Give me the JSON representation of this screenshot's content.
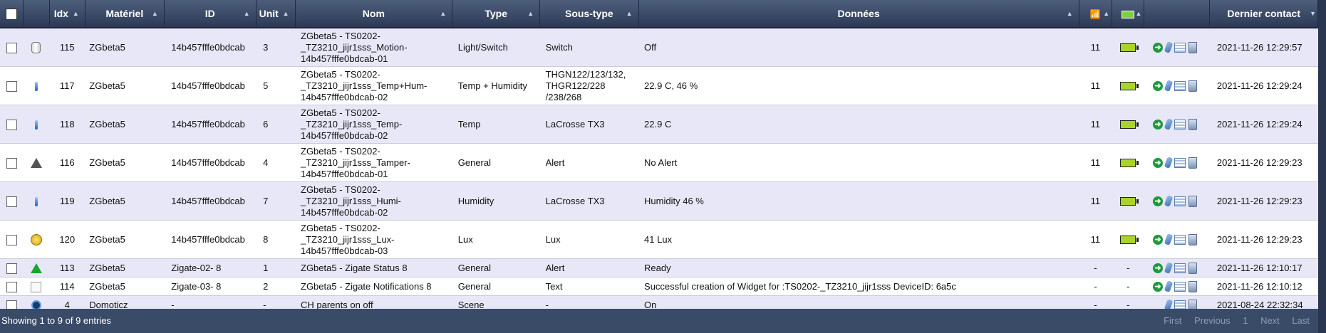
{
  "header": {
    "idx": "Idx",
    "materiel": "Matériel",
    "id": "ID",
    "unit": "Unit",
    "nom": "Nom",
    "type": "Type",
    "soustype": "Sous-type",
    "donnees": "Données",
    "dernier": "Dernier contact"
  },
  "rows": [
    {
      "icon": "cylinder-icon",
      "idx": "115",
      "mat": "ZGbeta5",
      "id": "14b457fffe0bdcab",
      "unit": "3",
      "nom_lines": [
        "ZGbeta5 - TS0202-",
        "_TZ3210_jijr1sss_Motion-",
        "14b457fffe0bdcab-01"
      ],
      "type": "Light/Switch",
      "sub_lines": [
        "Switch"
      ],
      "data": "Off",
      "signal": "11",
      "battery": true,
      "go": true,
      "last": "2021-11-26 12:29:57"
    },
    {
      "icon": "thermometer-icon",
      "idx": "117",
      "mat": "ZGbeta5",
      "id": "14b457fffe0bdcab",
      "unit": "5",
      "nom_lines": [
        "ZGbeta5 - TS0202-",
        "_TZ3210_jijr1sss_Temp+Hum-",
        "14b457fffe0bdcab-02"
      ],
      "type": "Temp + Humidity",
      "sub_lines": [
        "THGN122/123/132,",
        "THGR122/228",
        "/238/268"
      ],
      "data": "22.9 C, 46 %",
      "signal": "11",
      "battery": true,
      "go": true,
      "last": "2021-11-26 12:29:24"
    },
    {
      "icon": "thermometer-icon",
      "idx": "118",
      "mat": "ZGbeta5",
      "id": "14b457fffe0bdcab",
      "unit": "6",
      "nom_lines": [
        "ZGbeta5 - TS0202-",
        "_TZ3210_jijr1sss_Temp-",
        "14b457fffe0bdcab-02"
      ],
      "type": "Temp",
      "sub_lines": [
        "LaCrosse TX3"
      ],
      "data": "22.9 C",
      "signal": "11",
      "battery": true,
      "go": true,
      "last": "2021-11-26 12:29:24"
    },
    {
      "icon": "warning-icon",
      "idx": "116",
      "mat": "ZGbeta5",
      "id": "14b457fffe0bdcab",
      "unit": "4",
      "nom_lines": [
        "ZGbeta5 - TS0202-",
        "_TZ3210_jijr1sss_Tamper-",
        "14b457fffe0bdcab-01"
      ],
      "type": "General",
      "sub_lines": [
        "Alert"
      ],
      "data": "No Alert",
      "signal": "11",
      "battery": true,
      "go": true,
      "last": "2021-11-26 12:29:23"
    },
    {
      "icon": "thermometer-icon",
      "idx": "119",
      "mat": "ZGbeta5",
      "id": "14b457fffe0bdcab",
      "unit": "7",
      "nom_lines": [
        "ZGbeta5 - TS0202-",
        "_TZ3210_jijr1sss_Humi-",
        "14b457fffe0bdcab-02"
      ],
      "type": "Humidity",
      "sub_lines": [
        "LaCrosse TX3"
      ],
      "data": "Humidity 46 %",
      "signal": "11",
      "battery": true,
      "go": true,
      "last": "2021-11-26 12:29:23"
    },
    {
      "icon": "lux-icon",
      "idx": "120",
      "mat": "ZGbeta5",
      "id": "14b457fffe0bdcab",
      "unit": "8",
      "nom_lines": [
        "ZGbeta5 - TS0202-",
        "_TZ3210_jijr1sss_Lux-",
        "14b457fffe0bdcab-03"
      ],
      "type": "Lux",
      "sub_lines": [
        "Lux"
      ],
      "data": "41 Lux",
      "signal": "11",
      "battery": true,
      "go": true,
      "last": "2021-11-26 12:29:23"
    },
    {
      "icon": "alert-green-icon",
      "idx": "113",
      "mat": "ZGbeta5",
      "id": "Zigate-02- 8",
      "unit": "1",
      "nom_lines": [
        "ZGbeta5 - Zigate Status 8"
      ],
      "type": "General",
      "sub_lines": [
        "Alert"
      ],
      "data": "Ready",
      "signal": "-",
      "battery_text": "-",
      "go": true,
      "last": "2021-11-26 12:10:17"
    },
    {
      "icon": "notification-icon",
      "idx": "114",
      "mat": "ZGbeta5",
      "id": "Zigate-03- 8",
      "unit": "2",
      "nom_lines": [
        "ZGbeta5 - Zigate Notifications 8"
      ],
      "type": "General",
      "sub_lines": [
        "Text"
      ],
      "data": "Successful creation of Widget for :TS0202-_TZ3210_jijr1sss DeviceID: 6a5c",
      "signal": "-",
      "battery_text": "-",
      "go": true,
      "last": "2021-11-26 12:10:12"
    },
    {
      "icon": "scene-icon",
      "idx": "4",
      "mat": "Domoticz",
      "id": "-",
      "unit": "-",
      "nom_lines": [
        "CH parents on off"
      ],
      "type": "Scene",
      "sub_lines": [
        "-"
      ],
      "data": "On",
      "signal": "-",
      "battery_text": "-",
      "go": false,
      "last": "2021-08-24 22:32:34"
    }
  ],
  "footer": {
    "info": "Showing 1 to 9 of 9 entries",
    "first": "First",
    "previous": "Previous",
    "page": "1",
    "next": "Next",
    "last": "Last"
  }
}
